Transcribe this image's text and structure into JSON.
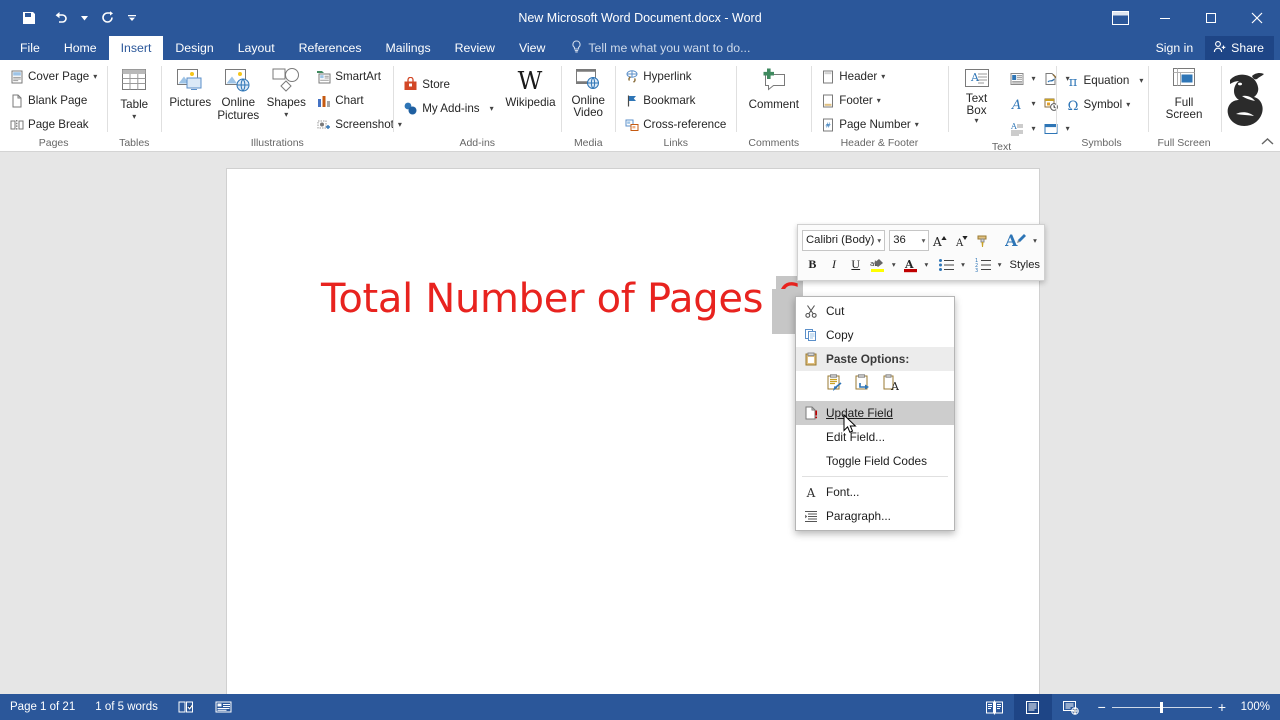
{
  "titlebar": {
    "document_title": "New Microsoft Word Document.docx - Word",
    "quick_access": [
      {
        "name": "save-icon",
        "label": "Save"
      },
      {
        "name": "undo-icon",
        "label": "Undo"
      },
      {
        "name": "redo-icon",
        "label": "Redo"
      },
      {
        "name": "customize-qat-icon",
        "label": "Customize Quick Access Toolbar"
      }
    ],
    "ribbon_display_options": "Ribbon Display Options",
    "minimize": "Minimize",
    "restore": "Restore Down",
    "close": "Close"
  },
  "tabs": [
    {
      "label": "File",
      "active": false
    },
    {
      "label": "Home",
      "active": false
    },
    {
      "label": "Insert",
      "active": true
    },
    {
      "label": "Design",
      "active": false
    },
    {
      "label": "Layout",
      "active": false
    },
    {
      "label": "References",
      "active": false
    },
    {
      "label": "Mailings",
      "active": false
    },
    {
      "label": "Review",
      "active": false
    },
    {
      "label": "View",
      "active": false
    }
  ],
  "tellme": {
    "placeholder": "Tell me what you want to do..."
  },
  "account": {
    "signin": "Sign in",
    "share": "Share"
  },
  "ribbon": {
    "groups": [
      {
        "label": "Pages",
        "items": [
          {
            "label": "Cover Page",
            "icon": "cover-page-icon",
            "dropdown": true
          },
          {
            "label": "Blank Page",
            "icon": "blank-page-icon",
            "dropdown": false
          },
          {
            "label": "Page Break",
            "icon": "page-break-icon",
            "dropdown": false
          }
        ]
      },
      {
        "label": "Tables",
        "items": [
          {
            "label": "Table",
            "icon": "table-icon",
            "dropdown": true
          }
        ]
      },
      {
        "label": "Illustrations",
        "items": [
          {
            "label": "Pictures",
            "icon": "pictures-icon",
            "dropdown": false
          },
          {
            "label": "Online Pictures",
            "icon": "online-pictures-icon",
            "dropdown": false
          },
          {
            "label": "Shapes",
            "icon": "shapes-icon",
            "dropdown": true
          },
          {
            "label": "SmartArt",
            "icon": "smartart-icon",
            "dropdown": false
          },
          {
            "label": "Chart",
            "icon": "chart-icon",
            "dropdown": false
          },
          {
            "label": "Screenshot",
            "icon": "screenshot-icon",
            "dropdown": true
          }
        ]
      },
      {
        "label": "Add-ins",
        "items": [
          {
            "label": "Store",
            "icon": "store-icon",
            "dropdown": false
          },
          {
            "label": "My Add-ins",
            "icon": "my-addins-icon",
            "dropdown": true
          },
          {
            "label": "Wikipedia",
            "icon": "wikipedia-icon",
            "dropdown": false
          }
        ]
      },
      {
        "label": "Media",
        "items": [
          {
            "label": "Online Video",
            "icon": "online-video-icon",
            "dropdown": false
          }
        ]
      },
      {
        "label": "Links",
        "items": [
          {
            "label": "Hyperlink",
            "icon": "hyperlink-icon",
            "dropdown": false
          },
          {
            "label": "Bookmark",
            "icon": "bookmark-icon",
            "dropdown": false
          },
          {
            "label": "Cross-reference",
            "icon": "cross-reference-icon",
            "dropdown": false
          }
        ]
      },
      {
        "label": "Comments",
        "items": [
          {
            "label": "Comment",
            "icon": "comment-icon",
            "dropdown": false
          }
        ]
      },
      {
        "label": "Header & Footer",
        "items": [
          {
            "label": "Header",
            "icon": "header-icon",
            "dropdown": true
          },
          {
            "label": "Footer",
            "icon": "footer-icon",
            "dropdown": true
          },
          {
            "label": "Page Number",
            "icon": "page-number-icon",
            "dropdown": true
          }
        ]
      },
      {
        "label": "Text",
        "items": [
          {
            "label": "Text Box",
            "icon": "text-box-icon",
            "dropdown": true
          },
          {
            "label": "Drop Cap",
            "icon": "drop-cap-icon",
            "dropdown": true
          },
          {
            "label": "WordArt",
            "icon": "wordart-icon",
            "dropdown": true
          },
          {
            "label": "Quick Parts",
            "icon": "quick-parts-icon",
            "dropdown": true
          },
          {
            "label": "Signature Line",
            "icon": "signature-line-icon",
            "dropdown": true
          },
          {
            "label": "Date & Time",
            "icon": "date-time-icon",
            "dropdown": false
          },
          {
            "label": "Object",
            "icon": "object-icon",
            "dropdown": true
          }
        ]
      },
      {
        "label": "Symbols",
        "items": [
          {
            "label": "Equation",
            "icon": "equation-icon",
            "dropdown": true
          },
          {
            "label": "Symbol",
            "icon": "symbol-icon",
            "dropdown": true
          }
        ]
      },
      {
        "label": "Full Screen",
        "items": [
          {
            "label": "Full Screen",
            "icon": "full-screen-icon",
            "dropdown": false
          }
        ]
      }
    ],
    "collapse": "Collapse the Ribbon",
    "decoration": "dragon-graphic"
  },
  "mini_toolbar": {
    "font_name": "Calibri (Body)",
    "font_size": "36",
    "grow_font": "A",
    "shrink_font": "A",
    "format_painter": "format-painter",
    "styles_label": "Styles",
    "bold": "B",
    "italic": "I",
    "underline": "U"
  },
  "context_menu": {
    "items": [
      {
        "label": "Cut",
        "icon": "cut-icon",
        "type": "item",
        "highlighted": false
      },
      {
        "label": "Copy",
        "icon": "copy-icon",
        "type": "item",
        "highlighted": false
      },
      {
        "label": "Paste Options:",
        "icon": "paste-icon",
        "type": "header",
        "highlighted": false
      },
      {
        "label": "",
        "type": "paste-icons",
        "icons": [
          "keep-source-formatting-icon",
          "merge-formatting-icon",
          "keep-text-only-icon"
        ]
      },
      {
        "label": "Update Field",
        "icon": "update-field-icon",
        "type": "item",
        "highlighted": true
      },
      {
        "label": "Edit Field...",
        "icon": "",
        "type": "item",
        "highlighted": false
      },
      {
        "label": "Toggle Field Codes",
        "icon": "",
        "type": "item",
        "highlighted": false
      },
      {
        "label": "Font...",
        "icon": "font-icon",
        "type": "item",
        "highlighted": false
      },
      {
        "label": "Paragraph...",
        "icon": "paragraph-icon",
        "type": "item",
        "highlighted": false
      }
    ]
  },
  "document": {
    "heading_text": "Total Number of Pages ",
    "field_value": "6",
    "text_color": "#e8231f"
  },
  "statusbar": {
    "page": "Page 1 of 21",
    "words": "1 of 5 words",
    "proofing_icon": "proofing-errors-icon",
    "macro_icon": "macro-recording-icon",
    "views": [
      {
        "name": "read-mode-icon",
        "active": false
      },
      {
        "name": "print-layout-icon",
        "active": true
      },
      {
        "name": "web-layout-icon",
        "active": false
      }
    ],
    "zoom_out": "−",
    "zoom_in": "+",
    "zoom_level": "100%"
  }
}
